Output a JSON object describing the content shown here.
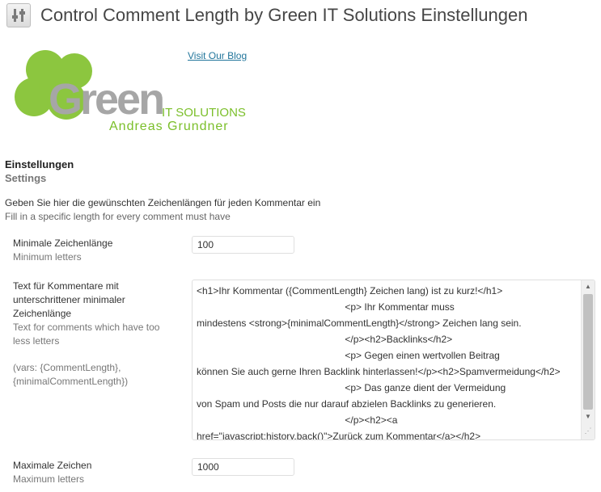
{
  "page": {
    "title": "Control Comment Length by Green IT Solutions Einstellungen",
    "blog_link": "Visit Our Blog"
  },
  "logo": {
    "brand_text": "Green",
    "it_text": "IT SOLUTIONS",
    "owner_text": "Andreas Grundner",
    "brand_color": "#7bbf2a"
  },
  "section": {
    "title": "Einstellungen",
    "subtitle": "Settings",
    "description_de": "Geben Sie hier die gewünschten Zeichenlängen für jeden Kommentar ein",
    "description_en": "Fill in a specific length for every comment must have"
  },
  "fields": {
    "min_length": {
      "label": "Minimale Zeichenlänge",
      "sublabel": "Minimum letters",
      "value": "100"
    },
    "short_text": {
      "label": "Text für Kommentare mit unterschrittener minimaler Zeichenlänge",
      "sublabel": "Text for comments which have too less letters",
      "vars": "(vars: {CommentLength}, {minimalCommentLength})",
      "value": "<h1>Ihr Kommentar ({CommentLength} Zeichen lang) ist zu kurz!</h1>\n                                                       <p> Ihr Kommentar muss\nmindestens <strong>{minimalCommentLength}</strong> Zeichen lang sein.\n                                                       </p><h2>Backlinks</h2>\n                                                       <p> Gegen einen wertvollen Beitrag\nkönnen Sie auch gerne Ihren Backlink hinterlassen!</p><h2>Spamvermeidung</h2>\n                                                       <p> Das ganze dient der Vermeidung\nvon Spam und Posts die nur darauf abzielen Backlinks zu generieren.\n                                                       </p><h2><a\nhref=\"javascript:history.back()\">Zurück zum Kommentar</a></h2>"
    },
    "max_length": {
      "label": "Maximale Zeichen",
      "sublabel": "Maximum letters",
      "value": "1000"
    }
  }
}
